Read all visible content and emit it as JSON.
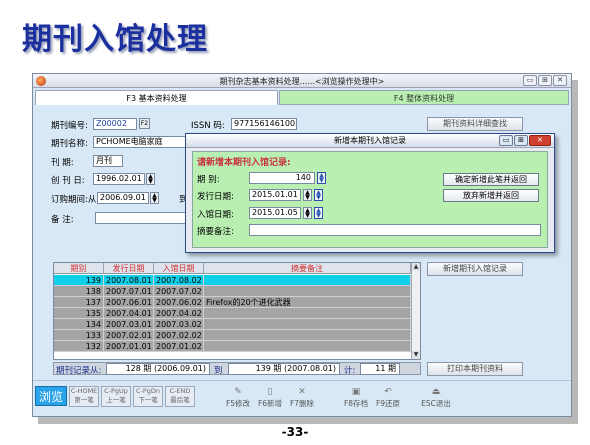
{
  "page_title": "期刊入馆处理",
  "window": {
    "title": "期刊杂志基本资料处理......<浏览操作处理中>",
    "buttons": [
      "▭",
      "⊞",
      "✕"
    ]
  },
  "tabs": [
    {
      "label": "F3 基本资料处理",
      "active": true
    },
    {
      "label": "F4 整体资料处理",
      "active": false
    }
  ],
  "form": {
    "journal_no_label": "期刊编号:",
    "journal_no": "Z00002",
    "f2_label": "F2",
    "issn_label": "ISSN 码:",
    "issn": "9771561461005",
    "detail_search": "期刊资料详细查找",
    "journal_name_label": "期刊名称:",
    "journal_name": "PCHOME电脑家庭",
    "period_label": "刊 期:",
    "period": "月刊",
    "start_label": "创 刊 日:",
    "start_date": "1996.02.01",
    "sub_label": "订购期间:从",
    "sub_from": "2006.09.01",
    "sub_to_label": "到",
    "remark_label": "备 注:"
  },
  "grid": {
    "headers": [
      "期别",
      "发行日期",
      "入馆日期",
      "摘要备注"
    ],
    "rows": [
      {
        "no": "139",
        "issue": "2007.08.01",
        "arrive": "2007.08.02",
        "note": "",
        "selected": true
      },
      {
        "no": "138",
        "issue": "2007.07.01",
        "arrive": "2007.07.02",
        "note": "",
        "selected": false
      },
      {
        "no": "137",
        "issue": "2007.06.01",
        "arrive": "2007.06.02",
        "note": "Firefox的20个进化武器",
        "selected": false
      },
      {
        "no": "135",
        "issue": "2007.04.01",
        "arrive": "2007.04.02",
        "note": "",
        "selected": false
      },
      {
        "no": "134",
        "issue": "2007.03.01",
        "arrive": "2007.03.02",
        "note": "",
        "selected": false
      },
      {
        "no": "133",
        "issue": "2007.02.01",
        "arrive": "2007.02.02",
        "note": "",
        "selected": false
      },
      {
        "no": "132",
        "issue": "2007.01.01",
        "arrive": "2007.01.02",
        "note": "",
        "selected": false
      }
    ]
  },
  "status": {
    "range_label": "期刊记录从:",
    "from": "128 期 (2006.09.01)",
    "to_label": "到",
    "to": "139 期 (2007.08.01)",
    "count_label": "计:",
    "count": "11 期"
  },
  "side_buttons": {
    "add_issue": "新增期刊入馆记录",
    "print": "打印本期刊资料"
  },
  "toolbar": {
    "browse": "浏览",
    "nav": [
      {
        "key": "C-HOME",
        "label": "第一笔"
      },
      {
        "key": "C-PgUp",
        "label": "上一笔"
      },
      {
        "key": "C-PgDn",
        "label": "下一笔"
      },
      {
        "key": "C-END",
        "label": "最后笔"
      }
    ],
    "tools": [
      {
        "icon": "✎",
        "label": "F5修改"
      },
      {
        "icon": "▯",
        "label": "F6新增"
      },
      {
        "icon": "✕",
        "label": "F7删除"
      },
      {
        "icon": "▣",
        "label": "F8存档"
      },
      {
        "icon": "↶",
        "label": "F9还原"
      },
      {
        "icon": "⏏",
        "label": "ESC退出"
      }
    ]
  },
  "dialog": {
    "title": "新增本期刊入馆记录",
    "heading": "请新增本期刊入馆记录:",
    "issue_label": "期 别:",
    "issue": "140",
    "release_label": "发行日期:",
    "release": "2015.01.01",
    "arrive_label": "入馆日期:",
    "arrive": "2015.01.05",
    "memo_label": "摘要备注:",
    "memo": "",
    "confirm": "确定新增此笔并返回",
    "cancel": "放弃新增并返回"
  },
  "page_number": "-33-"
}
